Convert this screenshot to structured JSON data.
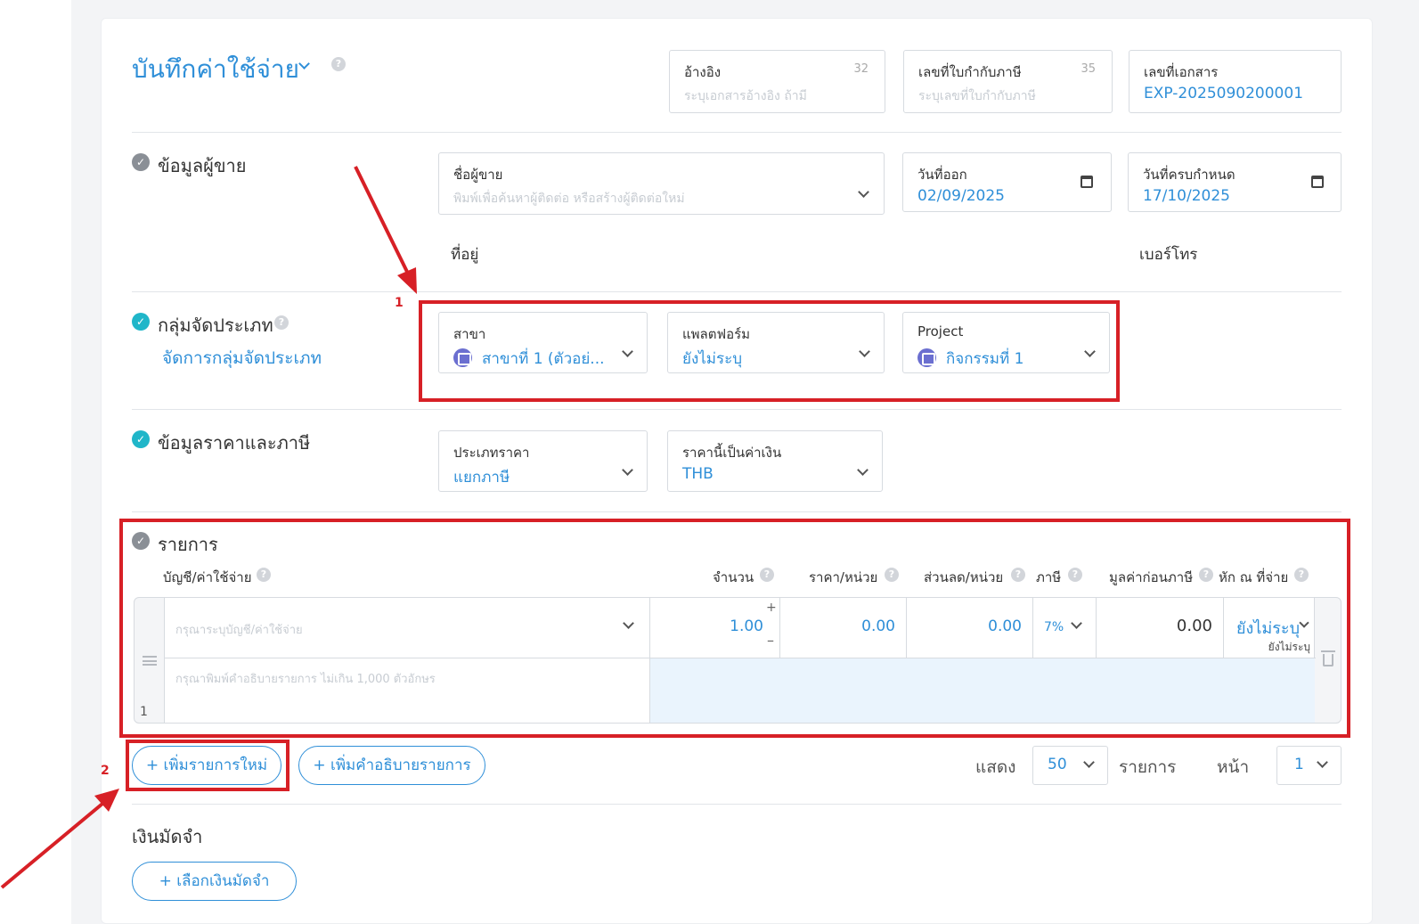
{
  "header": {
    "title": "บันทึกค่าใช้จ่าย",
    "reference": {
      "label": "อ้างอิง",
      "count": "32",
      "placeholder": "ระบุเอกสารอ้างอิง ถ้ามี"
    },
    "tax_invoice": {
      "label": "เลขที่ใบกำกับภาษี",
      "count": "35",
      "placeholder": "ระบุเลขที่ใบกำกับภาษี"
    },
    "doc_no": {
      "label": "เลขที่เอกสาร",
      "value": "EXP-2025090200001"
    }
  },
  "vendor": {
    "section_title": "ข้อมูลผู้ขาย",
    "name_label": "ชื่อผู้ขาย",
    "name_placeholder": "พิมพ์เพื่อค้นหาผู้ติดต่อ หรือสร้างผู้ติดต่อใหม่",
    "issue_date_label": "วันที่ออก",
    "issue_date": "02/09/2025",
    "due_date_label": "วันที่ครบกำหนด",
    "due_date": "17/10/2025",
    "address_label": "ที่อยู่",
    "phone_label": "เบอร์โทร"
  },
  "classification": {
    "section_title": "กลุ่มจัดประเภท",
    "manage_link": "จัดการกลุ่มจัดประเภท",
    "branch_label": "สาขา",
    "branch_value": "สาขาที่ 1 (ตัวอย่...",
    "platform_label": "แพลตฟอร์ม",
    "platform_value": "ยังไม่ระบุ",
    "project_label": "Project",
    "project_value": "กิจกรรมที่ 1"
  },
  "pricing": {
    "section_title": "ข้อมูลราคาและภาษี",
    "price_type_label": "ประเภทราคา",
    "price_type_value": "แยกภาษี",
    "currency_label": "ราคานี้เป็นค่าเงิน",
    "currency_value": "THB"
  },
  "items": {
    "section_title": "รายการ",
    "columns": {
      "account": "บัญชี/ค่าใช้จ่าย",
      "qty": "จำนวน",
      "unit_price": "ราคา/หน่วย",
      "discount": "ส่วนลด/หน่วย",
      "tax": "ภาษี",
      "pre_tax": "มูลค่าก่อนภาษี",
      "withholding": "หัก ณ ที่จ่าย"
    },
    "row": {
      "index": "1",
      "account_placeholder": "กรุณาระบุบัญชี/ค่าใช้จ่าย",
      "description_placeholder": "กรุณาพิมพ์คำอธิบายรายการ ไม่เกิน 1,000 ตัวอักษร",
      "qty": "1.00",
      "unit_price": "0.00",
      "discount": "0.00",
      "tax": "7%",
      "pre_tax": "0.00",
      "withholding": "ยังไม่ระบุ",
      "withholding_sub": "ยังไม่ระบุ"
    }
  },
  "actions": {
    "add_item": "+ เพิ่มรายการใหม่",
    "add_description": "+ เพิ่มคำอธิบายรายการ"
  },
  "pagination": {
    "show_label": "แสดง",
    "per_page": "50",
    "items_label": "รายการ",
    "page_label": "หน้า",
    "page": "1"
  },
  "deposit": {
    "title": "เงินมัดจำ",
    "select_button": "+ เลือกเงินมัดจำ"
  },
  "annotations": {
    "one": "1",
    "two": "2"
  },
  "colors": {
    "accent": "#2f8fd8",
    "highlight": "#d72026",
    "teal": "#20b6c9"
  }
}
